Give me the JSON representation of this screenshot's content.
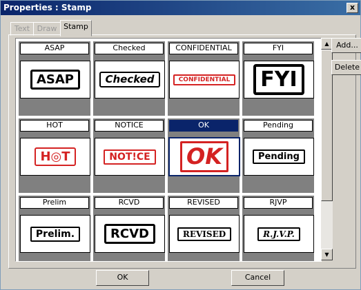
{
  "window": {
    "title": "Properties : Stamp",
    "close_label": "x"
  },
  "tabs": [
    {
      "label": "Text",
      "active": false
    },
    {
      "label": "Draw",
      "active": false
    },
    {
      "label": "Stamp",
      "active": true
    }
  ],
  "stamps": [
    {
      "label": "ASAP"
    },
    {
      "label": "Checked"
    },
    {
      "label": "CONFIDENTIAL"
    },
    {
      "label": "FYI"
    },
    {
      "label": "HOT"
    },
    {
      "label": "NOTICE"
    },
    {
      "label": "OK",
      "selected": true
    },
    {
      "label": "Pending"
    },
    {
      "label": "Prelim"
    },
    {
      "label": "RCVD"
    },
    {
      "label": "REVISED"
    },
    {
      "label": "RJVP"
    }
  ],
  "stamp_art": [
    {
      "text": "ASAP",
      "color": "#000000"
    },
    {
      "text": "Checked",
      "color": "#000000"
    },
    {
      "text": "CONFIDENTIAL",
      "color": "#d42222"
    },
    {
      "text": "FYI",
      "color": "#000000"
    },
    {
      "text": "H◎T",
      "color": "#d42222"
    },
    {
      "text": "NOT!CE",
      "color": "#d42222"
    },
    {
      "text": "OK",
      "color": "#d42222"
    },
    {
      "text": "Pending",
      "color": "#000000"
    },
    {
      "text": "Prelim.",
      "color": "#000000"
    },
    {
      "text": "RCVD",
      "color": "#000000"
    },
    {
      "text": "REVISED",
      "color": "#000000"
    },
    {
      "text": "R.J.V.P.",
      "color": "#000000"
    }
  ],
  "side_buttons": {
    "add": "Add...",
    "delete": "Delete"
  },
  "footer": {
    "ok": "OK",
    "cancel": "Cancel"
  },
  "colors": {
    "title_start": "#0a246a",
    "title_end": "#3a6ea5",
    "dialog_bg": "#d4d0c8",
    "cell_bg": "#808080",
    "selection": "#0a246a",
    "stamp_red": "#d42222"
  }
}
